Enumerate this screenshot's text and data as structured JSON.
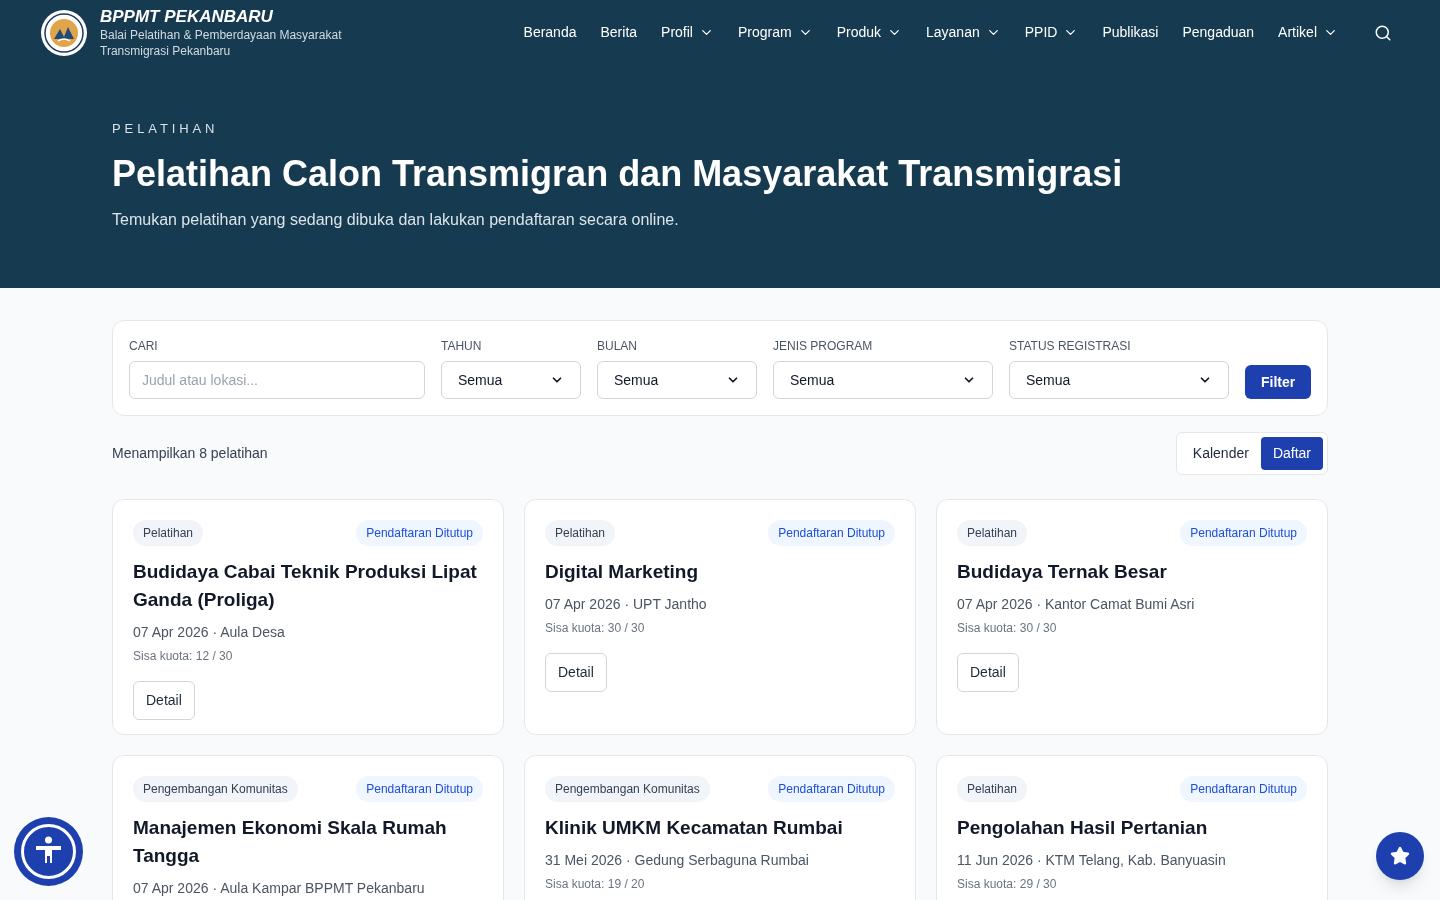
{
  "brand": {
    "title": "BPPMT PEKANBARU",
    "subtitle_lines": [
      "Balai Pelatihan & Pemberdayaan Masyarakat",
      "Transmigrasi Pekanbaru"
    ]
  },
  "nav": [
    {
      "label": "Beranda",
      "dropdown": false
    },
    {
      "label": "Berita",
      "dropdown": false
    },
    {
      "label": "Profil",
      "dropdown": true
    },
    {
      "label": "Program",
      "dropdown": true
    },
    {
      "label": "Produk",
      "dropdown": true
    },
    {
      "label": "Layanan",
      "dropdown": true
    },
    {
      "label": "PPID",
      "dropdown": true
    },
    {
      "label": "Publikasi",
      "dropdown": false
    },
    {
      "label": "Pengaduan",
      "dropdown": false
    },
    {
      "label": "Artikel",
      "dropdown": true
    }
  ],
  "hero": {
    "eyebrow": "PELATIHAN",
    "title": "Pelatihan Calon Transmigran dan Masyarakat Transmigrasi",
    "subtitle": "Temukan pelatihan yang sedang dibuka dan lakukan pendaftaran secara online."
  },
  "filters": {
    "search": {
      "label": "CARI",
      "placeholder": "Judul atau lokasi..."
    },
    "selects": [
      {
        "label": "TAHUN",
        "value": "Semua"
      },
      {
        "label": "BULAN",
        "value": "Semua"
      },
      {
        "label": "JENIS PROGRAM",
        "value": "Semua"
      },
      {
        "label": "STATUS REGISTRASI",
        "value": "Semua"
      }
    ],
    "button": "Filter"
  },
  "summary": "Menampilkan 8 pelatihan",
  "views": [
    {
      "label": "Kalender",
      "selected": false
    },
    {
      "label": "Daftar",
      "selected": true
    }
  ],
  "cards": [
    {
      "category": "Pelatihan",
      "status": "Pendaftaran Ditutup",
      "title": "Budidaya Cabai Teknik Produksi Lipat Ganda (Proliga)",
      "meta": "07 Apr 2026 · Aula Desa",
      "quota": "Sisa kuota: 12 / 30",
      "button": "Detail"
    },
    {
      "category": "Pelatihan",
      "status": "Pendaftaran Ditutup",
      "title": "Digital Marketing",
      "meta": "07 Apr 2026 · UPT Jantho",
      "quota": "Sisa kuota: 30 / 30",
      "button": "Detail"
    },
    {
      "category": "Pelatihan",
      "status": "Pendaftaran Ditutup",
      "title": "Budidaya Ternak Besar",
      "meta": "07 Apr 2026 · Kantor Camat Bumi Asri",
      "quota": "Sisa kuota: 30 / 30",
      "button": "Detail"
    },
    {
      "category": "Pengembangan Komunitas",
      "status": "Pendaftaran Ditutup",
      "title": "Manajemen Ekonomi Skala Rumah Tangga",
      "meta": "07 Apr 2026 · Aula Kampar BPPMT Pekanbaru"
    },
    {
      "category": "Pengembangan Komunitas",
      "status": "Pendaftaran Ditutup",
      "title": "Klinik UMKM Kecamatan Rumbai",
      "meta": "31 Mei 2026 · Gedung Serbaguna Rumbai",
      "quota": "Sisa kuota: 19 / 20"
    },
    {
      "category": "Pelatihan",
      "status": "Pendaftaran Ditutup",
      "title": "Pengolahan Hasil Pertanian",
      "meta": "11 Jun 2026 · KTM Telang, Kab. Banyuasin",
      "quota": "Sisa kuota: 29 / 30"
    }
  ]
}
